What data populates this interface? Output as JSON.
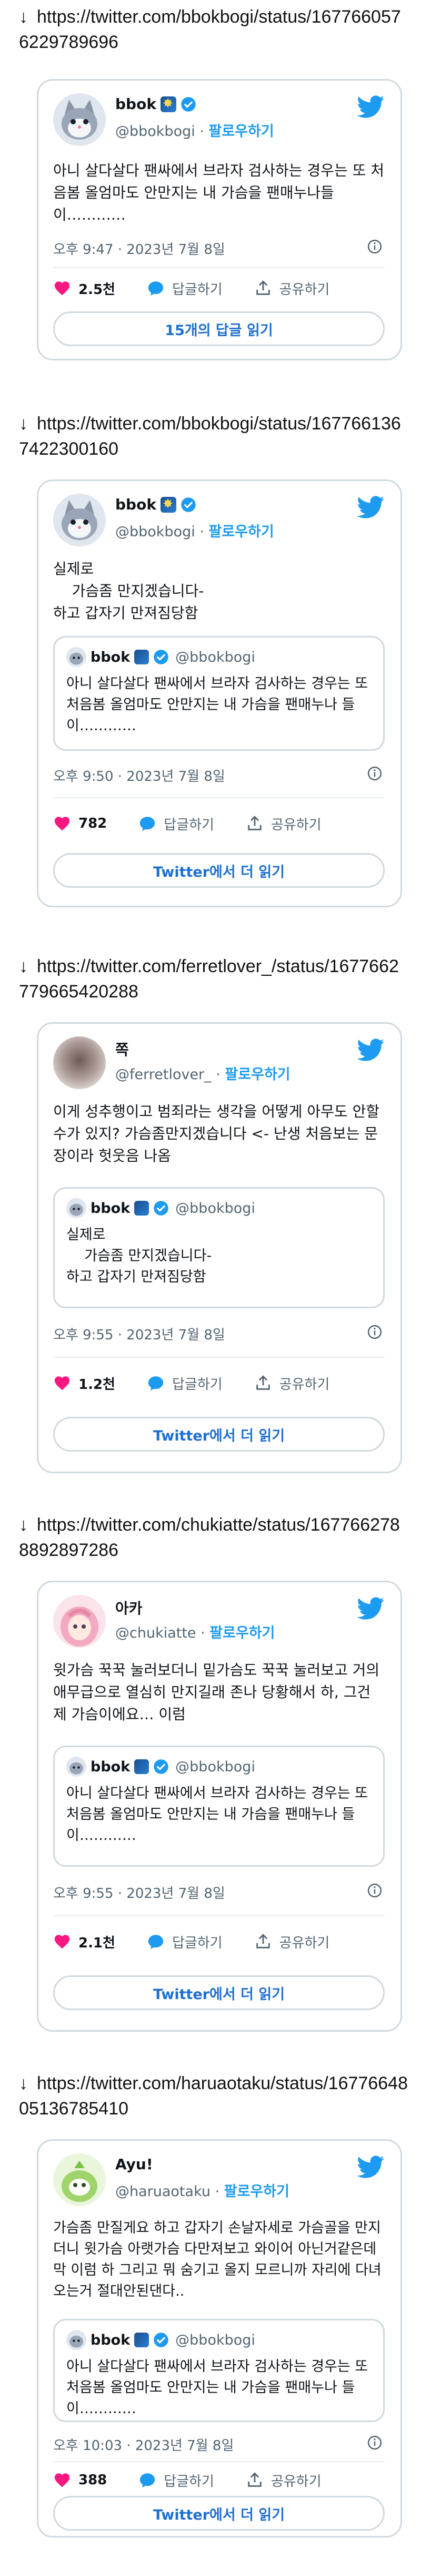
{
  "arrow": "↓",
  "colors": {
    "accent": "#1d9bf0",
    "like": "#f91880",
    "border": "#cfd9de",
    "text": "#0f1419",
    "muted": "#536471"
  },
  "posts": [
    {
      "url": "https://twitter.com/bbokbogi/status/1677660576229789696",
      "author": {
        "name": "bbok",
        "handle": "@bbokbogi",
        "follow": "팔로우하기",
        "avatar": "cat-avatar"
      },
      "text": "아니 살다살다 팬싸에서 브라자 검사하는 경우는 또 처음봄 올엄마도 안만지는 내 가슴을 팬매누나들 이…………",
      "quote": null,
      "time": "오후 9:47 · 2023년 7월 8일",
      "likes": "2.5천",
      "reply_label": "답글하기",
      "share_label": "공유하기",
      "button": "15개의 답글 읽기"
    },
    {
      "url": "https://twitter.com/bbokbogi/status/1677661367422300160",
      "author": {
        "name": "bbok",
        "handle": "@bbokbogi",
        "follow": "팔로우하기",
        "avatar": "cat-avatar"
      },
      "text": "실제로\n    가슴좀 만지겠습니다-\n하고 갑자기 만져짐당함",
      "quote": {
        "name": "bbok",
        "handle": "@bbokbogi",
        "text": "아니 살다살다 팬싸에서 브라자 검사하는 경우는 또 처음봄 올엄마도 안만지는 내 가슴을 팬매누나 들이…………"
      },
      "time": "오후 9:50 · 2023년 7월 8일",
      "likes": "782",
      "reply_label": "답글하기",
      "share_label": "공유하기",
      "button": "Twitter에서 더 읽기"
    },
    {
      "url": "https://twitter.com/ferretlover_/status/1677662779665420288",
      "author": {
        "name": "쪽",
        "handle": "@ferretlover_",
        "follow": "팔로우하기",
        "avatar": "blurred-avatar"
      },
      "text": "이게 성추행이고 범죄라는 생각을 어떻게 아무도 안할 수가 있지? 가슴좀만지겠습니다 <- 난생 처음보는 문장이라 헛웃음 나옴",
      "quote": {
        "name": "bbok",
        "handle": "@bbokbogi",
        "text": "실제로\n    가슴좀 만지겠습니다-\n하고 갑자기 만져짐당함"
      },
      "time": "오후 9:55 · 2023년 7월 8일",
      "likes": "1.2천",
      "reply_label": "답글하기",
      "share_label": "공유하기",
      "button": "Twitter에서 더 읽기"
    },
    {
      "url": "https://twitter.com/chukiatte/status/1677662788892897286",
      "author": {
        "name": "아카",
        "handle": "@chukiatte",
        "follow": "팔로우하기",
        "avatar": "anime-avatar"
      },
      "text": "윗가슴 꾹꾹 눌러보더니 밑가슴도 꾹꾹 눌러보고 거의 애무급으로 열심히 만지길래 존나 당황해서 하, 그건 제 가슴이에요… 이럼",
      "quote": {
        "name": "bbok",
        "handle": "@bbokbogi",
        "text": "아니 살다살다 팬싸에서 브라자 검사하는 경우는 또 처음봄 올엄마도 안만지는 내 가슴을 팬매누나 들이…………"
      },
      "time": "오후 9:55 · 2023년 7월 8일",
      "likes": "2.1천",
      "reply_label": "답글하기",
      "share_label": "공유하기",
      "button": "Twitter에서 더 읽기"
    },
    {
      "url": "https://twitter.com/haruaotaku/status/1677664805136785410",
      "author": {
        "name": "Ayu!",
        "handle": "@haruaotaku",
        "follow": "팔로우하기",
        "avatar": "green-avatar"
      },
      "text": "가슴좀 만질게요 하고 갑자기 손날자세로 가슴골을 만지더니 윗가슴 아랫가슴 다만져보고 와이어 아닌거같은데 막 이럼 하 그리고 뭐 숨기고 올지 모르니까 자리에 다녀오는거 절대안된댄다..",
      "quote": {
        "name": "bbok",
        "handle": "@bbokbogi",
        "text": "아니 살다살다 팬싸에서 브라자 검사하는 경우는 또 처음봄 올엄마도 안만지는 내 가슴을 팬매누나 들이…………"
      },
      "time": "오후 10:03 · 2023년 7월 8일",
      "likes": "388",
      "reply_label": "답글하기",
      "share_label": "공유하기",
      "button": "Twitter에서 더 읽기"
    }
  ]
}
